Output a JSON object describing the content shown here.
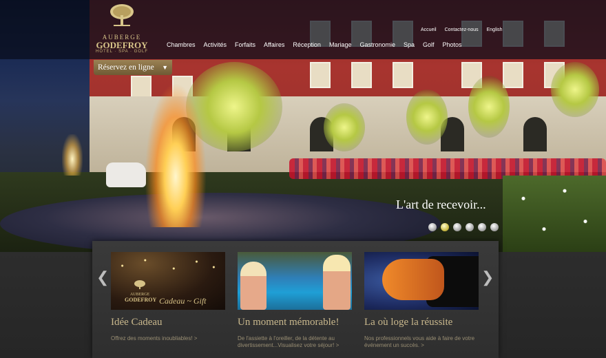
{
  "logo": {
    "line1": "AUBERGE",
    "line2": "GODEFROY",
    "line3": "HÔTEL · SPA · GOLF"
  },
  "utility_nav": [
    "Accueil",
    "Contactez-nous",
    "English"
  ],
  "main_nav": [
    "Chambres",
    "Activités",
    "Forfaits",
    "Affaires",
    "Réception",
    "Mariage",
    "Gastronomie",
    "Spa",
    "Golf",
    "Photos"
  ],
  "reserve": {
    "label": "Réservez en ligne",
    "icon": "chevron-down-icon"
  },
  "hero": {
    "slogan": "L'art de recevoir...",
    "slide_count": 6,
    "active_slide": 2
  },
  "cards": [
    {
      "title": "Idée Cadeau",
      "desc": "Offrez des moments inoubliables! >",
      "thumb_line1": "AUBERGE",
      "thumb_line2": "GODEFROY",
      "thumb_gift": "Cadeau ~ Gift"
    },
    {
      "title": "Un moment mémorable!",
      "desc": "De l'assiette à l'oreiller, de la détente au divertissement...Visualisez votre séjour! >"
    },
    {
      "title": "La où loge la réussite",
      "desc": "Nos professionnels vous aide à faire de votre événement un succès. >"
    }
  ],
  "colors": {
    "gold": "#d9c68a",
    "card_title": "#c9b88d",
    "card_text": "#9a8f74",
    "reserve_bg": "#8a7148"
  }
}
